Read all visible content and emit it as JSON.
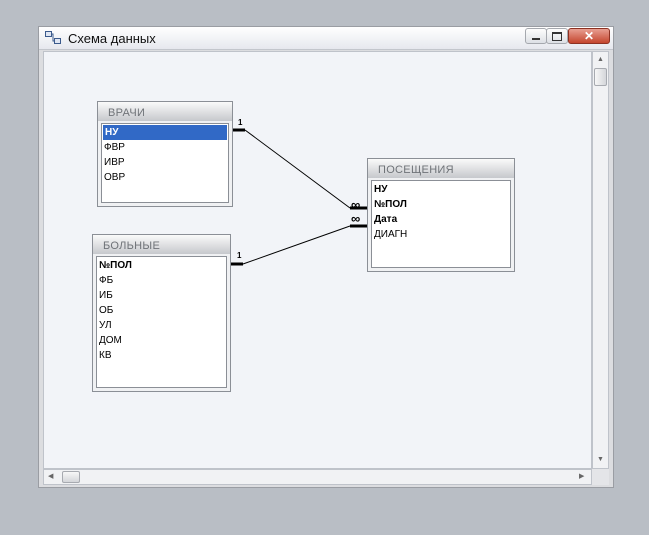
{
  "window": {
    "title": "Схема данных"
  },
  "tables": {
    "vrachi": {
      "name": "ВРАЧИ",
      "fields": [
        {
          "label": "НУ",
          "key": true,
          "selected": true
        },
        {
          "label": "ФВР",
          "key": false,
          "selected": false
        },
        {
          "label": "ИВР",
          "key": false,
          "selected": false
        },
        {
          "label": "ОВР",
          "key": false,
          "selected": false
        }
      ]
    },
    "bolnye": {
      "name": "БОЛЬНЫЕ",
      "fields": [
        {
          "label": "№ПОЛ",
          "key": true,
          "selected": false
        },
        {
          "label": "ФБ",
          "key": false,
          "selected": false
        },
        {
          "label": "ИБ",
          "key": false,
          "selected": false
        },
        {
          "label": "ОБ",
          "key": false,
          "selected": false
        },
        {
          "label": "УЛ",
          "key": false,
          "selected": false
        },
        {
          "label": "ДОМ",
          "key": false,
          "selected": false
        },
        {
          "label": "КВ",
          "key": false,
          "selected": false
        }
      ]
    },
    "poseshcheniya": {
      "name": "ПОСЕЩЕНИЯ",
      "fields": [
        {
          "label": "НУ",
          "key": true,
          "selected": false
        },
        {
          "label": "№ПОЛ",
          "key": true,
          "selected": false
        },
        {
          "label": "Дата",
          "key": true,
          "selected": false
        },
        {
          "label": "ДИАГН",
          "key": false,
          "selected": false
        }
      ]
    }
  },
  "relations": {
    "one_label": "1",
    "many_label": "∞"
  }
}
